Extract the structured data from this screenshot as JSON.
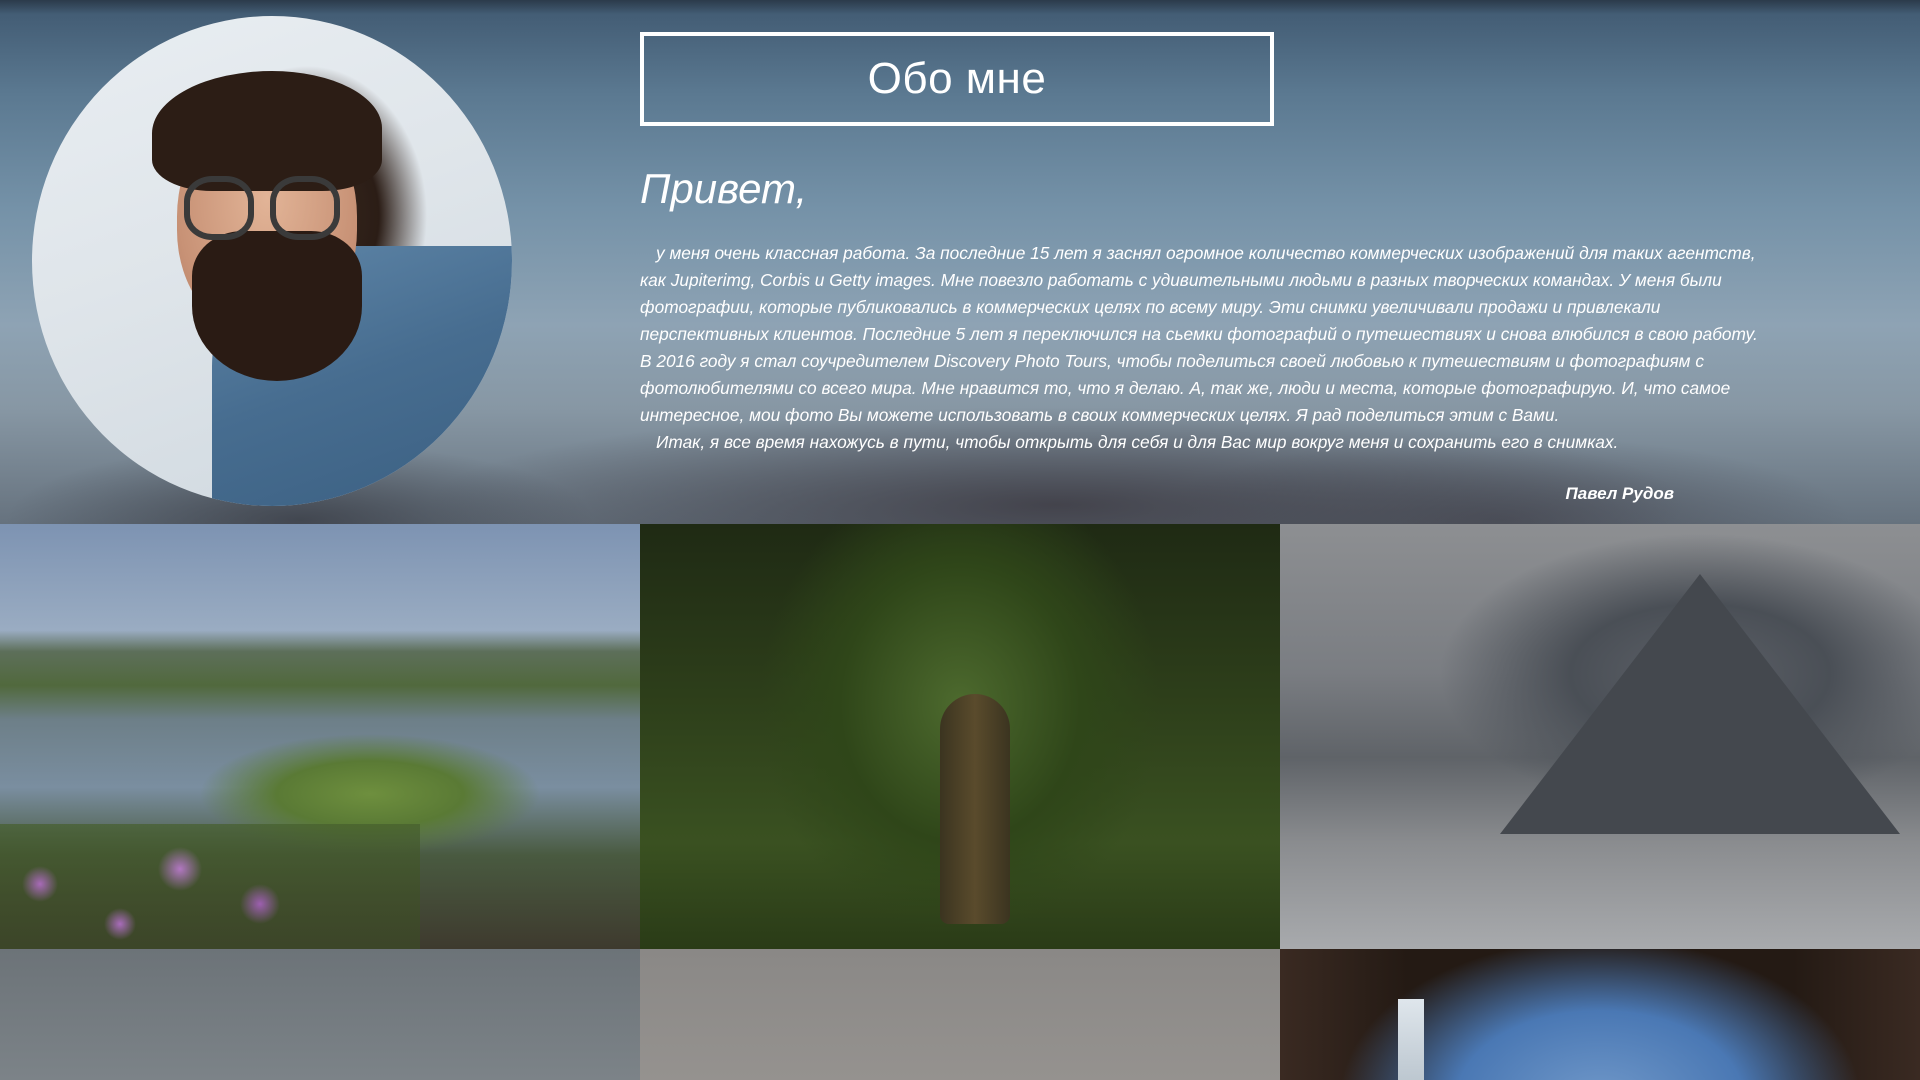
{
  "about": {
    "title": "Обо мне",
    "greeting": "Привет,",
    "paragraphs": [
      "у меня очень классная работа. За последние 15 лет я заснял огромное количество коммерческих изображений для таких агентств, как Jupiterimg, Corbis и Getty images. Мне повезло работать с удивительными людьми в разных творческих командах. У меня были фотографии, которые публиковались в коммерческих целях по всему миру. Эти снимки увеличивали продажи и привлекали перспективных клиентов. Последние 5 лет я переключился на сьемки фотографий о путешествиях и снова влюбился в свою работу. В 2016 году я стал соучредителем Discovery Photo Tours, чтобы поделиться своей любовью к путешествиям и фотографиям с фотолюбителями со всего мира. Мне нравится то, что я делаю. А, так же, люди и места, которые фотографирую. И, что самое интересное, мои фото Вы можете использовать в своих коммерческих целях. Я рад поделиться этим с Вами.",
      "Итак, я все время нахожусь в пути, чтобы открыть для себя и для Вас мир вокруг меня и сохранить его в снимках."
    ],
    "signature": "Павел Рудов"
  },
  "colors": {
    "text": "#ffffff",
    "title_border": "#ffffff"
  }
}
